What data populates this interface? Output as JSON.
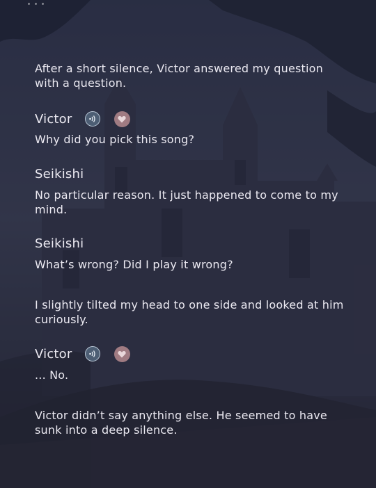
{
  "colors": {
    "background": "#2c2d40",
    "text": "#eceaf2",
    "voice_button": "#4d5e74",
    "like_button": "#a07b82"
  },
  "icons": {
    "menu": "menu-dots-icon",
    "voice": "voice-play-icon",
    "like": "heart-icon"
  },
  "dialogue": {
    "n1": "After a short silence, Victor answered my question with a question.",
    "s1_name": "Victor",
    "s1_line": "Why did you pick this song?",
    "s2_name": "Seikishi",
    "s2_line": "No particular reason. It just happened to come to my mind.",
    "s3_name": "Seikishi",
    "s3_line": "What’s wrong? Did I play it wrong?",
    "n2": "I slightly tilted my head to one side and looked at him curiously.",
    "s4_name": "Victor",
    "s4_line": "... No.",
    "n3": "Victor didn’t say anything else. He seemed to have sunk into a deep silence."
  }
}
